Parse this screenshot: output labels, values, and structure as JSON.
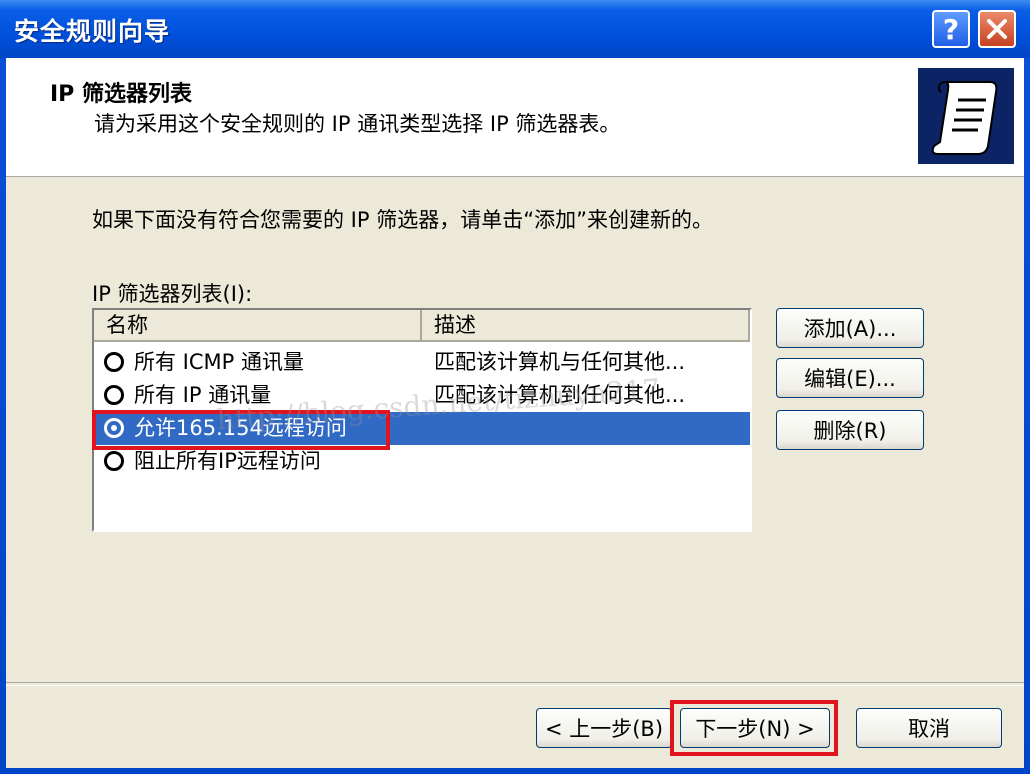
{
  "window": {
    "title": "安全规则向导",
    "help_label": "?",
    "close_label": "✕"
  },
  "header": {
    "title": "IP 筛选器列表",
    "subtitle": "请为采用这个安全规则的 IP 通讯类型选择 IP 筛选器表。",
    "icon": "scroll-document-icon"
  },
  "body": {
    "intro": "如果下面没有符合您需要的 IP 筛选器，请单击“添加”来创建新的。",
    "list_label": "IP 筛选器列表(I):"
  },
  "listview": {
    "columns": [
      "名称",
      "描述"
    ],
    "rows": [
      {
        "name": "所有 ICMP 通讯量",
        "desc": "匹配该计算机与任何其他...",
        "checked": false,
        "selected": false
      },
      {
        "name": "所有 IP 通讯量",
        "desc": "匹配该计算机到任何其他...",
        "checked": false,
        "selected": false
      },
      {
        "name": "允许165.154远程访问",
        "desc": "",
        "checked": true,
        "selected": true
      },
      {
        "name": "阻止所有IP远程访问",
        "desc": "",
        "checked": false,
        "selected": false
      }
    ]
  },
  "side_buttons": {
    "add": "添加(A)...",
    "edit": "编辑(E)...",
    "delete": "删除(R)"
  },
  "footer_buttons": {
    "back": "< 上一步(B)",
    "next": "下一步(N) >",
    "cancel": "取消"
  },
  "watermark": "http://blog.csdn.net/tiznuya217",
  "colors": {
    "title_bar": "#0050dc",
    "selection": "#316ac5",
    "highlight_box": "#e0141e",
    "dialog_bg": "#ece9d8"
  }
}
